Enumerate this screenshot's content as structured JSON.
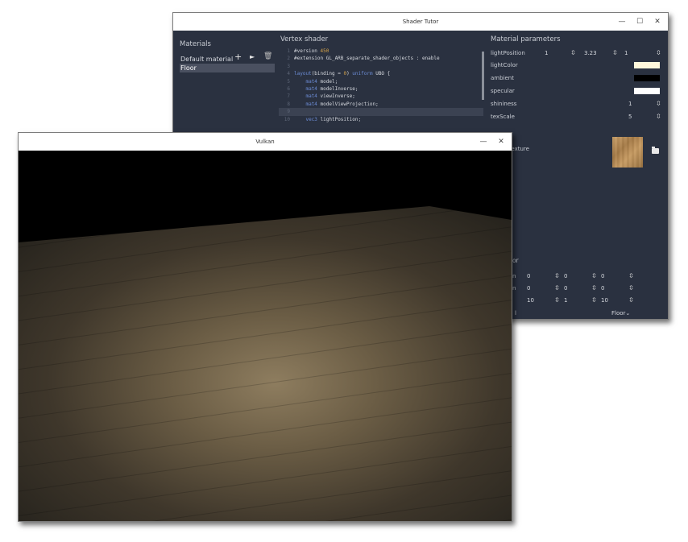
{
  "shader_window": {
    "title": "Shader Tutor",
    "controls": [
      "—",
      "☐",
      "✕"
    ],
    "materials": {
      "title": "Materials",
      "add_icon": "+",
      "run_icon": "►",
      "delete_icon": "🗑",
      "items": [
        {
          "label": "Default material",
          "selected": false
        },
        {
          "label": "Floor",
          "selected": true
        }
      ]
    },
    "editor": {
      "title": "Vertex shader",
      "lines": [
        {
          "n": "1",
          "text": "#version 450"
        },
        {
          "n": "2",
          "text": "#extension GL_ARB_separate_shader_objects : enable"
        },
        {
          "n": "3",
          "text": ""
        },
        {
          "n": "4",
          "text": "layout(binding = 0) uniform UBO {"
        },
        {
          "n": "5",
          "text": "    mat4 model;"
        },
        {
          "n": "6",
          "text": "    mat4 modelInverse;"
        },
        {
          "n": "7",
          "text": "    mat4 viewInverse;"
        },
        {
          "n": "8",
          "text": "    mat4 modelViewProjection;"
        },
        {
          "n": "9",
          "text": ""
        },
        {
          "n": "10",
          "text": "    vec3 lightPosition;"
        }
      ]
    },
    "params": {
      "title": "Material parameters",
      "lightPosition": {
        "label": "lightPosition",
        "v1": "1",
        "v2": "3.23",
        "v3": "1"
      },
      "lightColor": {
        "label": "lightColor",
        "color": "#fff8dc"
      },
      "ambient": {
        "label": "ambient",
        "color": "#000000"
      },
      "specular": {
        "label": "specular",
        "color": "#ffffff"
      },
      "shininess": {
        "label": "shininess",
        "value": "1"
      },
      "texScale": {
        "label": "texScale",
        "value": "5"
      },
      "texture": {
        "label": "eTexture"
      },
      "transform": {
        "title": "tor",
        "rows": [
          {
            "label": "n",
            "v1": "0",
            "v2": "0",
            "v3": "0"
          },
          {
            "label": "n",
            "v1": "0",
            "v2": "0",
            "v3": "0"
          },
          {
            "label": "",
            "v1": "10",
            "v2": "1",
            "v3": "10"
          }
        ],
        "mesh_label": "l",
        "mesh_value": "Floor"
      }
    }
  },
  "vulkan_window": {
    "title": "Vulkan",
    "controls": [
      "—",
      "✕"
    ]
  },
  "colors": {
    "panel_bg": "#2a3140",
    "selection": "#4a5060",
    "keyword": "#6c8cd5",
    "number": "#d9a54a",
    "floor_light": "#8a7a5e",
    "floor_dark": "#2e2a22"
  },
  "icons": [
    "plus-icon",
    "play-icon",
    "trash-icon",
    "spin-icon",
    "folder-icon",
    "chevron-down-icon",
    "minimize-icon",
    "maximize-icon",
    "close-icon"
  ]
}
